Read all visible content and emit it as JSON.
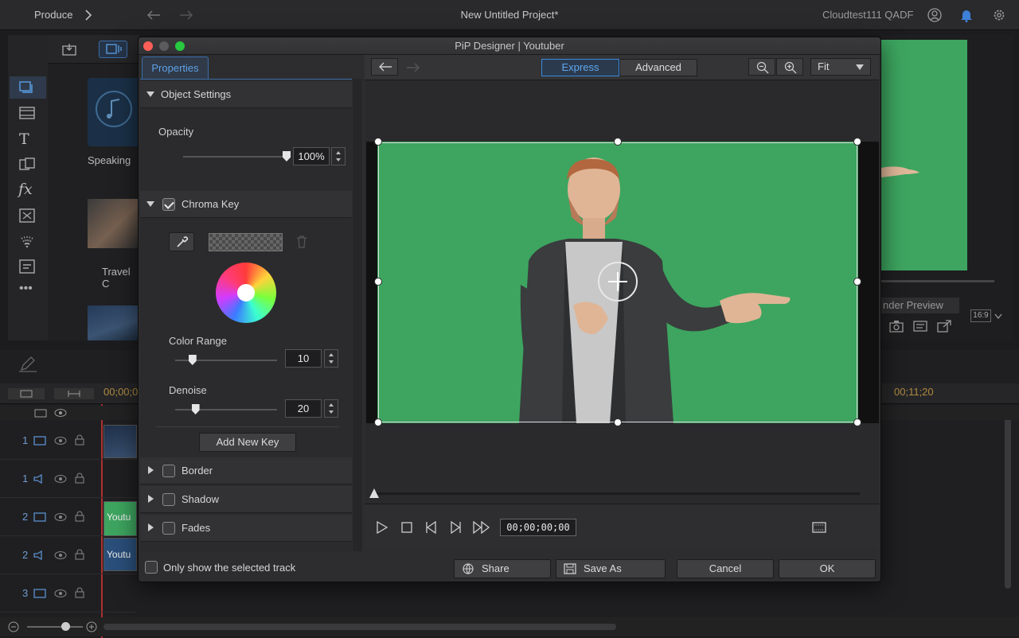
{
  "app": {
    "produce_label": "Produce",
    "project_title": "New Untitled Project*",
    "user_name": "Cloudtest111 QADF"
  },
  "library": {
    "items": [
      {
        "label": "Speaking"
      },
      {
        "label": "Travel C"
      }
    ]
  },
  "background_preview": {
    "render_preview_label": "nder Preview",
    "aspect_label": "16:9"
  },
  "timeline": {
    "timecode_start": "00;00;0",
    "timecode_end": "00;11;20",
    "tracks": [
      {
        "num": "1",
        "kind": "video"
      },
      {
        "num": "1",
        "kind": "audio"
      },
      {
        "num": "2",
        "kind": "video",
        "clip": "Youtu"
      },
      {
        "num": "2",
        "kind": "audio",
        "clip": "Youtu"
      },
      {
        "num": "3",
        "kind": "video"
      }
    ]
  },
  "dialog": {
    "title": "PiP Designer  |  Youtuber",
    "properties_tab": "Properties",
    "sections": {
      "object_settings": "Object Settings",
      "chroma_key": "Chroma Key",
      "border": "Border",
      "shadow": "Shadow",
      "fades": "Fades"
    },
    "opacity": {
      "label": "Opacity",
      "value": "100%",
      "level": 1.0
    },
    "chroma": {
      "color_range_label": "Color Range",
      "color_range_value": "10",
      "color_range_level": 0.17,
      "denoise_label": "Denoise",
      "denoise_value": "20",
      "denoise_level": 0.2,
      "add_key_label": "Add New Key"
    },
    "mode_tabs": {
      "express": "Express",
      "advanced": "Advanced"
    },
    "zoom_select": "Fit",
    "timecode": "00;00;00;00",
    "only_selected_track": "Only show the selected track",
    "buttons": {
      "share": "Share",
      "save_as": "Save As",
      "cancel": "Cancel",
      "ok": "OK"
    }
  },
  "colors": {
    "accent": "#3a6ea8",
    "accent_text": "#5ea0e6",
    "green_screen": "#3da55f",
    "traffic_red": "#fc5f57",
    "traffic_yellow": "#5b5b5d",
    "traffic_green": "#28c840"
  }
}
